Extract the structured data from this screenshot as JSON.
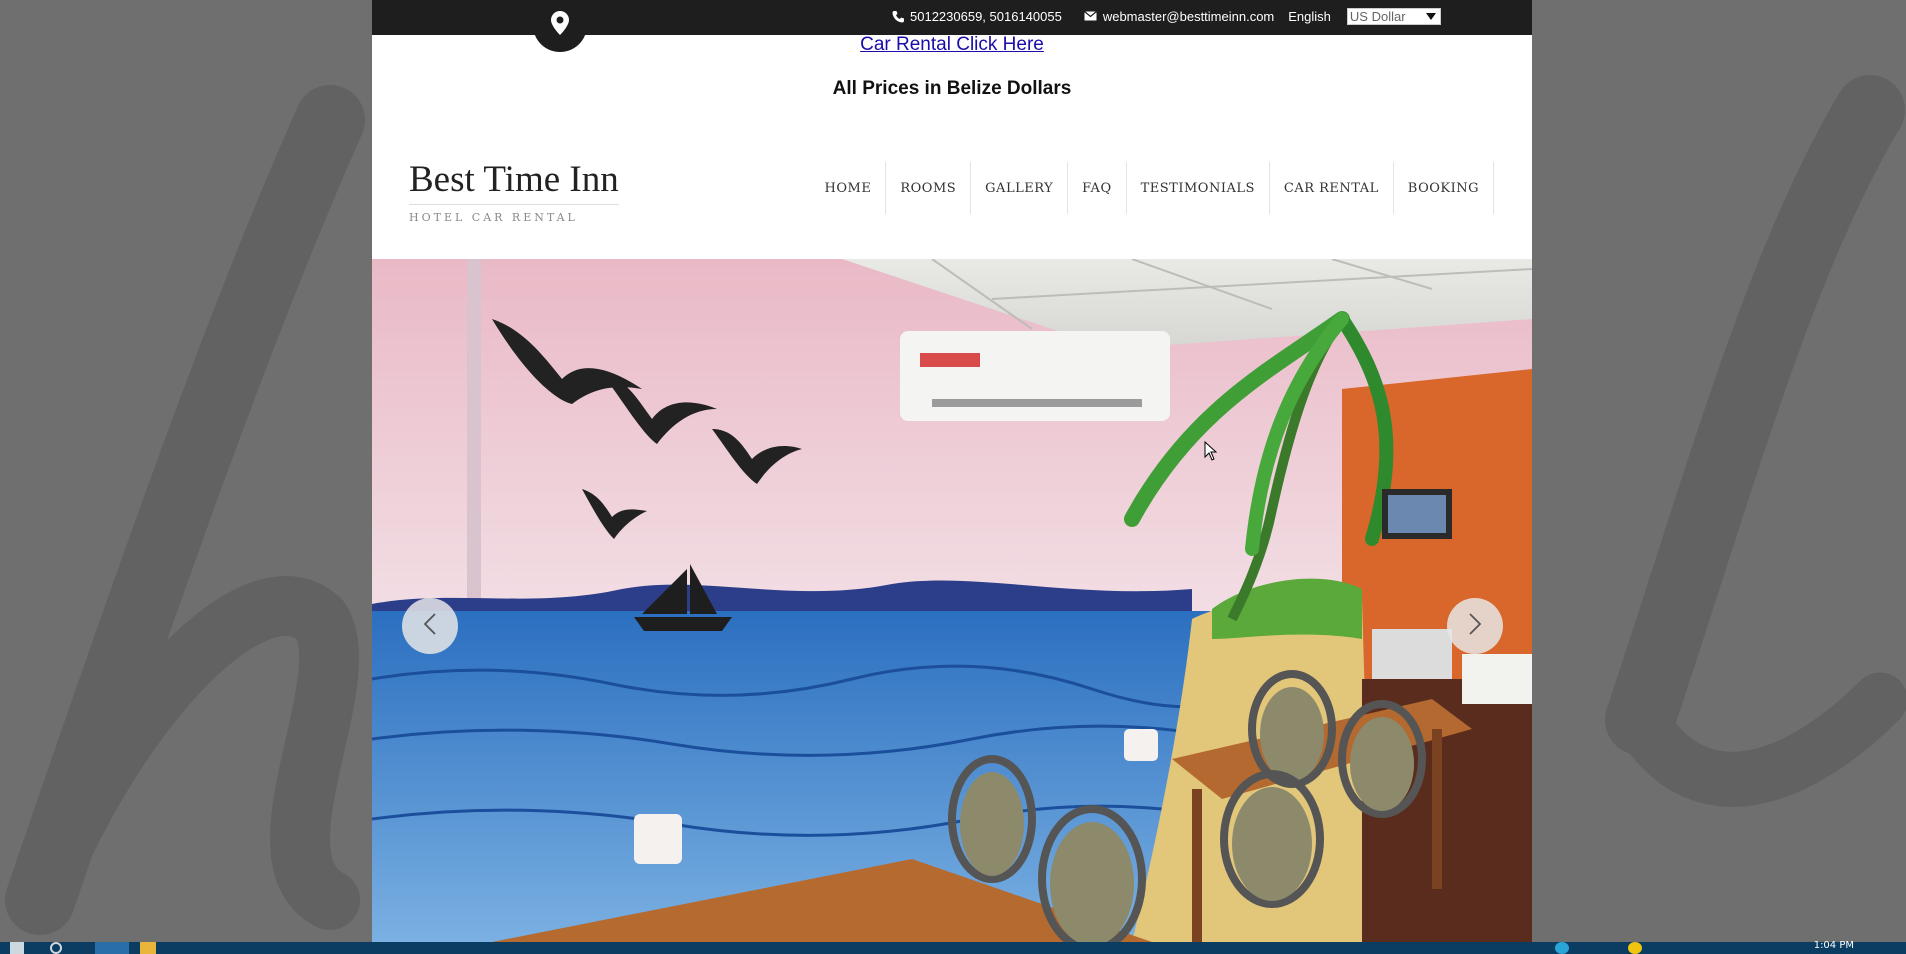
{
  "topbar": {
    "phone_icon": "phone-icon",
    "phone": "5012230659, 5016140055",
    "email_icon": "envelope-icon",
    "email": "webmaster@besttimeinn.com",
    "language": "English",
    "currency": "US Dollar",
    "location_icon": "map-pin-icon"
  },
  "notice": {
    "link_text": "Car Rental Click Here",
    "prices_text": "All Prices in Belize Dollars"
  },
  "brand": {
    "title": "Best Time Inn",
    "tagline": "HOTEL CAR RENTAL"
  },
  "nav": {
    "items": [
      {
        "label": "HOME"
      },
      {
        "label": "ROOMS"
      },
      {
        "label": "GALLERY"
      },
      {
        "label": "FAQ"
      },
      {
        "label": "TESTIMONIALS"
      },
      {
        "label": "CAR RENTAL"
      },
      {
        "label": "BOOKING"
      }
    ]
  },
  "slider": {
    "prev_icon": "chevron-left-icon",
    "next_icon": "chevron-right-icon"
  },
  "taskbar": {
    "clock": "1:04 PM"
  },
  "colors": {
    "topbar_bg": "#1e1e1e",
    "link": "#1a0dab",
    "page_bg": "#6f6f6f",
    "taskbar": "#0b3d62"
  }
}
